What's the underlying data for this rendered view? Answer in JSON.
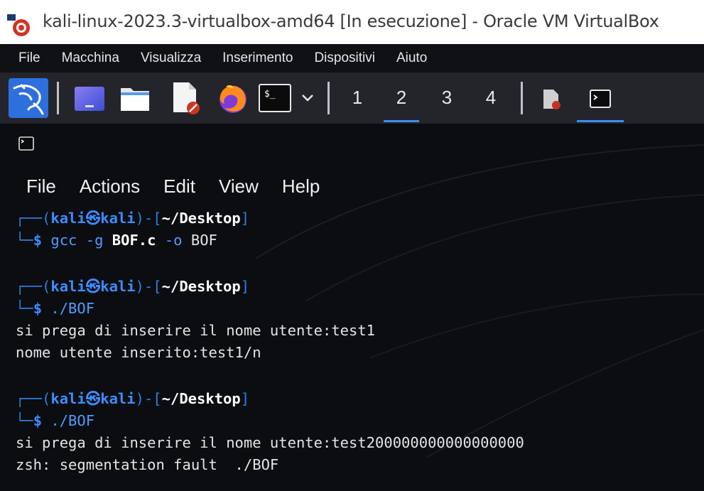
{
  "window": {
    "title": "kali-linux-2023.3-virtualbox-amd64 [In esecuzione] - Oracle VM VirtualBox"
  },
  "vbox_menu": [
    "File",
    "Macchina",
    "Visualizza",
    "Inserimento",
    "Dispositivi",
    "Aiuto"
  ],
  "panel": {
    "workspaces": [
      "1",
      "2",
      "3",
      "4"
    ],
    "active_workspace": "2",
    "icons": [
      "kali-menu-icon",
      "desktop-icon",
      "file-manager-icon",
      "text-editor-icon",
      "firefox-icon",
      "terminal-icon",
      "dropdown-chevron-icon",
      "window-editor-icon",
      "window-terminal-icon"
    ]
  },
  "terminal": {
    "menu": [
      "File",
      "Actions",
      "Edit",
      "View",
      "Help"
    ],
    "prompt": {
      "open": "┌──(",
      "user": "kali",
      "at": "㉿",
      "host": "kali",
      "mid": ")-[",
      "path": "~/Desktop",
      "close": "]",
      "second": "└─",
      "dollar": "$"
    },
    "blocks": [
      {
        "cmd_parts": [
          {
            "t": "gcc -g ",
            "style": "plain"
          },
          {
            "t": "BOF.c",
            "style": "bold"
          },
          {
            "t": " -o ",
            "style": "plain"
          },
          {
            "t": "BOF",
            "style": "white"
          }
        ],
        "output": []
      },
      {
        "cmd_parts": [
          {
            "t": "./BOF",
            "style": "plain"
          }
        ],
        "output": [
          "si prega di inserire il nome utente:test1",
          "nome utente inserito:test1/n"
        ]
      },
      {
        "cmd_parts": [
          {
            "t": "./BOF",
            "style": "plain"
          }
        ],
        "output": [
          "si prega di inserire il nome utente:test200000000000000000",
          "zsh: segmentation fault  ./BOF"
        ]
      }
    ]
  },
  "colors": {
    "prompt_blue": "#3e8cff",
    "accent": "#3d8bff",
    "panel_bg": "#23252b",
    "terminal_bg": "#0b0d10"
  }
}
